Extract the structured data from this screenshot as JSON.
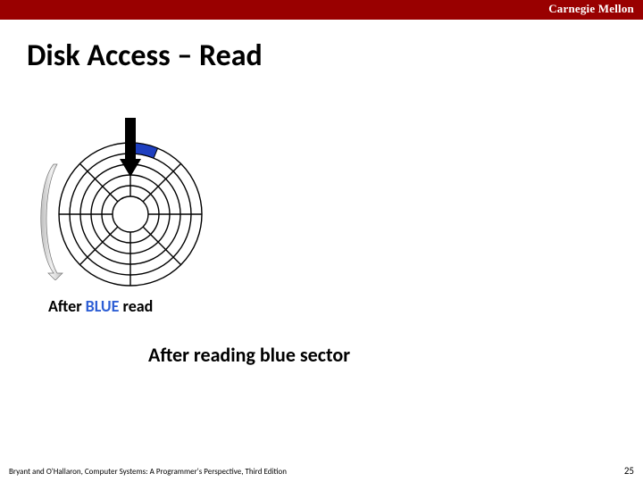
{
  "header": {
    "brand": "Carnegie Mellon"
  },
  "title": "Disk Access – Read",
  "caption_prefix": "After ",
  "caption_color_word": "BLUE",
  "caption_suffix": " read",
  "subcaption": "After reading blue sector",
  "footer": "Bryant and O'Hallaron, Computer Systems: A Programmer's Perspective, Third Edition",
  "page_number": "25"
}
